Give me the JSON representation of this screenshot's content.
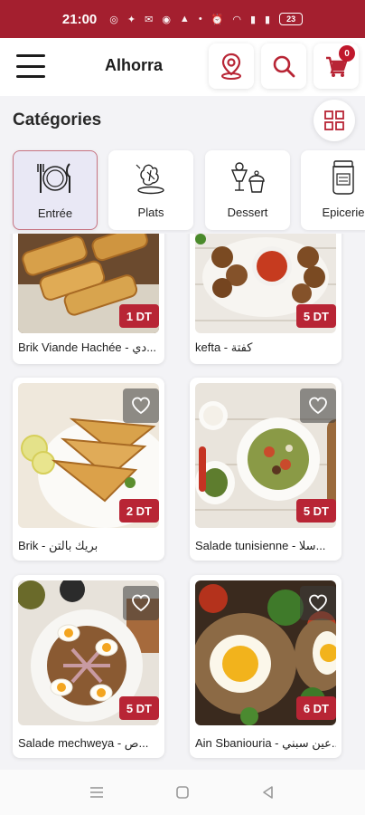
{
  "status_bar": {
    "time": "21:00",
    "battery": "23"
  },
  "app_bar": {
    "title": "Alhorra",
    "cart_count": "0"
  },
  "categories": {
    "title": "Catégories",
    "items": [
      {
        "label": "Entrée",
        "icon": "fork-knife-icon",
        "active": true
      },
      {
        "label": "Plats",
        "icon": "bird-dish-icon",
        "active": false
      },
      {
        "label": "Dessert",
        "icon": "dessert-icon",
        "active": false
      },
      {
        "label": "Epicerie",
        "icon": "jar-icon",
        "active": false
      }
    ]
  },
  "products": [
    {
      "name": "Brik Viande Hachée - دي...",
      "price": "1 DT"
    },
    {
      "name": "kefta - كفتة",
      "price": "5 DT"
    },
    {
      "name": "Brik - بريك بالتن",
      "price": "2 DT"
    },
    {
      "name": "Salade tunisienne - سلا...",
      "price": "5 DT"
    },
    {
      "name": "Salade mechweya - ص...",
      "price": "5 DT"
    },
    {
      "name": "Ain Sbaniouria - عين سبني...",
      "price": "6 DT"
    }
  ],
  "colors": {
    "brand": "#a41f2f",
    "price_badge": "#b82535",
    "active_chip": "#e9e8f5"
  }
}
